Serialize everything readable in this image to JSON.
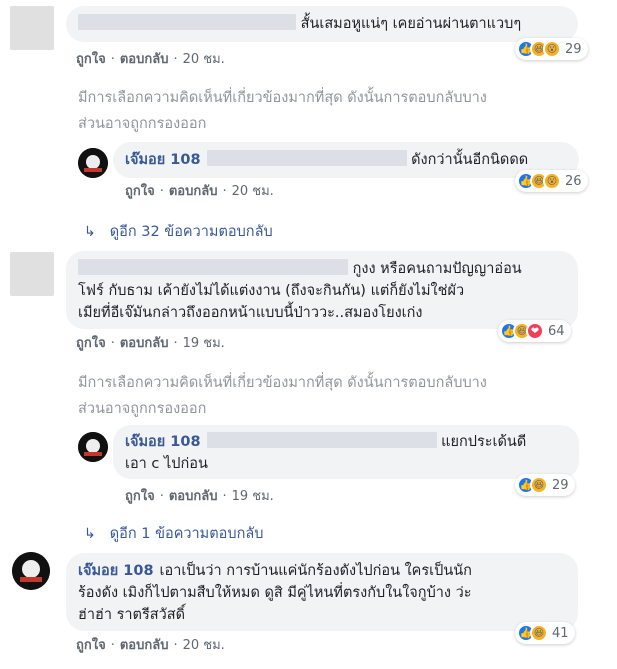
{
  "comments": [
    {
      "text": "สั้นเสมอหูแน่ๆ เคยอ่านผ่านตาแวบๆ",
      "reaction_count": "29",
      "actions": {
        "like": "ถูกใจ",
        "reply": "ตอบกลับ",
        "time": "20 ชม."
      }
    },
    {
      "author": "เจ๊มอย 108",
      "text": "ดังกว่านั้นอีกนิดดด",
      "reaction_count": "26",
      "actions": {
        "like": "ถูกใจ",
        "reply": "ตอบกลับ",
        "time": "20 ชม."
      }
    },
    {
      "text_line1": "กูงง หรือคนถามปัญญาอ่อน",
      "text_line2": "โฟร์ กับธาม เค้ายังไม่ได้แต่งงาน (ถึงจะกินกัน) แต่ก็ยังไม่ใช่ผัว",
      "text_line3": "เมียที่อีเจ๊มันกล่าวถึงออกหน้าแบบนี้ป่าววะ..สมองโยงเก่ง",
      "reaction_count": "64",
      "actions": {
        "like": "ถูกใจ",
        "reply": "ตอบกลับ",
        "time": "19 ชม."
      }
    },
    {
      "author": "เจ๊มอย 108",
      "text_line1": "แยกประเด้นดี",
      "text_line2": "เอา c ไปก่อน",
      "reaction_count": "29",
      "actions": {
        "like": "ถูกใจ",
        "reply": "ตอบกลับ",
        "time": "19 ชม."
      }
    },
    {
      "author": "เจ๊มอย 108",
      "text_line1": "เอาเป็นว่า การบ้านแค่นักร้องดังไปก่อน ใครเป็นนัก",
      "text_line2": "ร้องดัง เมิงก็ไปตามสืบให้หมด ดูสิ มีคู่ไหนที่ตรงกับในใจกูบ้าง ว่ะ",
      "text_line3": "ฮ่าฮ่า ราตรีสวัสดิ์",
      "reaction_count": "41",
      "actions": {
        "like": "ถูกใจ",
        "reply": "ตอบกลับ",
        "time": "20 ชม."
      }
    }
  ],
  "filter_note_line1": "มีการเลือกความคิดเห็นที่เกี่ยวข้องมากที่สุด ดังนั้นการตอบกลับบาง",
  "filter_note_line2": "ส่วนอาจถูกกรองออก",
  "more_replies_1": "ดูอีก 32 ข้อความตอบกลับ",
  "more_replies_2": "ดูอีก 1 ข้อความตอบกลับ",
  "icons": {
    "more_arrow": "arrow-return-icon",
    "like": "like-reaction-icon",
    "haha": "haha-reaction-icon",
    "wow": "wow-reaction-icon",
    "love": "love-reaction-icon"
  },
  "colors": {
    "author": "#385898",
    "bubble": "#f2f3f5",
    "meta": "#606770",
    "note": "#90949c"
  }
}
